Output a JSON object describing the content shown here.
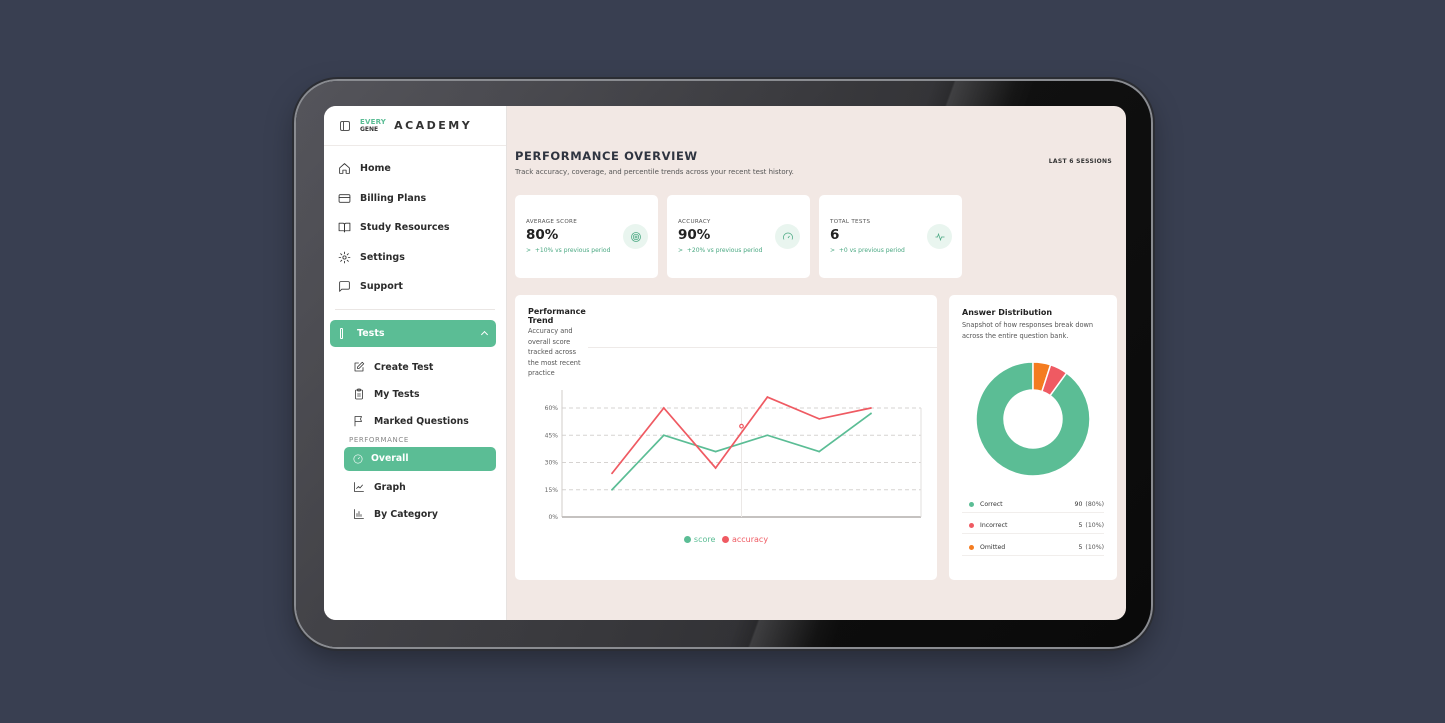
{
  "brand": {
    "logo_top": "EVERY",
    "logo_bottom": "GENE",
    "name": "ACADEMY"
  },
  "nav": [
    {
      "label": "Home",
      "icon": "home-icon"
    },
    {
      "label": "Billing Plans",
      "icon": "credit-card-icon"
    },
    {
      "label": "Study Resources",
      "icon": "book-icon"
    },
    {
      "label": "Settings",
      "icon": "gear-icon"
    },
    {
      "label": "Support",
      "icon": "message-icon"
    }
  ],
  "tests": {
    "label": "Tests",
    "items": [
      {
        "label": "Create Test",
        "icon": "edit-icon"
      },
      {
        "label": "My Tests",
        "icon": "clipboard-icon"
      },
      {
        "label": "Marked Questions",
        "icon": "flag-icon"
      }
    ],
    "performance_label": "PERFORMANCE",
    "performance_items": [
      {
        "label": "Overall",
        "icon": "gauge-icon",
        "active": true
      },
      {
        "label": "Graph",
        "icon": "line-chart-icon"
      },
      {
        "label": "By Category",
        "icon": "bar-chart-icon"
      }
    ]
  },
  "header": {
    "title": "PERFORMANCE OVERVIEW",
    "subtitle": "Track accuracy, coverage, and percentile trends across your recent test history.",
    "sessions": "LAST 6 SESSIONS"
  },
  "stats": [
    {
      "label": "AVERAGE SCORE",
      "value": "80%",
      "change": "+10% vs previous period",
      "icon": "target-icon"
    },
    {
      "label": "ACCURACY",
      "value": "90%",
      "change": "+20% vs previous period",
      "icon": "gauge-icon"
    },
    {
      "label": "TOTAL TESTS",
      "value": "6",
      "change": "+0 vs previous period",
      "icon": "activity-icon"
    }
  ],
  "trend_card": {
    "title": "Performance Trend",
    "subtitle": "Accuracy and overall score tracked across the most recent practice"
  },
  "chart_data": {
    "type": "line",
    "x": [
      1,
      2,
      3,
      4,
      5,
      6
    ],
    "ylim": [
      0,
      60
    ],
    "yticks": [
      "0%",
      "15%",
      "30%",
      "45%",
      "60%"
    ],
    "grid": true,
    "legend": "bottom-center",
    "series": [
      {
        "name": "score",
        "color": "#5bbd95",
        "values": [
          15,
          45,
          36,
          45,
          36,
          57
        ]
      },
      {
        "name": "accuracy",
        "color": "#ef5a62",
        "values": [
          24,
          60,
          27,
          66,
          54,
          60
        ]
      }
    ],
    "highlight_point": {
      "series": "accuracy",
      "x": 3.5,
      "y": 50
    }
  },
  "distribution": {
    "title": "Answer Distribution",
    "subtitle": "Snapshot of how responses break down across the entire question bank.",
    "rows": [
      {
        "label": "Correct",
        "amount": "90",
        "pct": "(80%)",
        "color": "#5bbd95",
        "value": 90
      },
      {
        "label": "Incorrect",
        "amount": "5",
        "pct": "(10%)",
        "color": "#ef5a62",
        "value": 5
      },
      {
        "label": "Omitted",
        "amount": "5",
        "pct": "(10%)",
        "color": "#f47c20",
        "value": 5
      }
    ]
  }
}
